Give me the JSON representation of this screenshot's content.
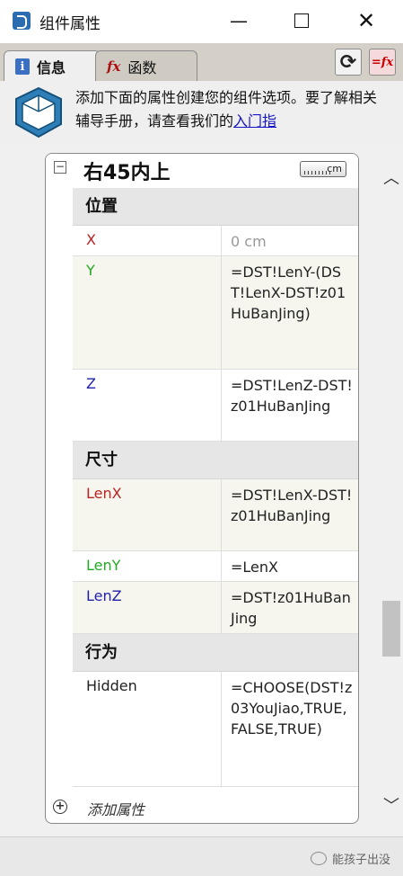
{
  "window": {
    "title": "组件属性",
    "min": "—",
    "close": "✕"
  },
  "tabs": [
    {
      "label": "信息",
      "icon": "info-icon",
      "icon_glyph": "i"
    },
    {
      "label": "函数",
      "icon": "fx-icon",
      "icon_glyph": "fx"
    }
  ],
  "toolbar": {
    "refresh_glyph": "⟳",
    "fx_glyph": "=fx"
  },
  "info": {
    "text": "添加下面的属性创建您的组件选项。要了解相关辅导手册，请查看我们的",
    "link": "入门指"
  },
  "component": {
    "name": "右45内上",
    "unit": "cm",
    "collapse_glyph": "−"
  },
  "sections": [
    {
      "title": "位置",
      "rows": [
        {
          "name": "X",
          "value": "0 cm",
          "color": "#b22222"
        },
        {
          "name": "Y",
          "value": "=DST!LenY-(DST!LenX-DST!z01HuBanJing)",
          "color": "#22aa22"
        },
        {
          "name": "Z",
          "value": "=DST!LenZ-DST!z01HuBanJing",
          "color": "#2222aa"
        }
      ]
    },
    {
      "title": "尺寸",
      "rows": [
        {
          "name": "LenX",
          "value": "=DST!LenX-DST!z01HuBanJing",
          "color": "#b22222"
        },
        {
          "name": "LenY",
          "value": "=LenX",
          "color": "#22aa22"
        },
        {
          "name": "LenZ",
          "value": "=DST!z01HuBanJing",
          "color": "#2222aa"
        }
      ]
    },
    {
      "title": "行为",
      "rows": [
        {
          "name": "Hidden",
          "value": "=CHOOSE(DST!z03YouJiao,TRUE,FALSE,TRUE)",
          "color": "#222222"
        }
      ]
    }
  ],
  "add_attr": {
    "label": "添加属性",
    "glyph": "+"
  },
  "scroll": {
    "up": "︿",
    "down": "﹀"
  },
  "watermark": "能孩子出没"
}
